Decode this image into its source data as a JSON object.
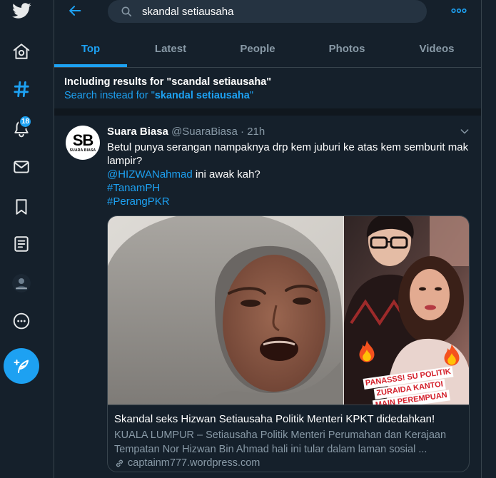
{
  "theme": {
    "bg": "#15202b",
    "border": "#38444d",
    "accent": "#1da1f2",
    "text": "#ffffff",
    "muted": "#8899a6",
    "search_bg": "#253341",
    "separator": "#10171e"
  },
  "sidebar": {
    "icons": [
      "twitter-logo",
      "home",
      "explore",
      "notifications",
      "messages",
      "bookmarks",
      "lists",
      "profile",
      "more",
      "compose-tweet"
    ],
    "active": "explore",
    "notifications_badge": "18"
  },
  "header": {
    "icons": [
      "back-arrow",
      "search",
      "more"
    ],
    "search": {
      "value": "skandal setiausaha"
    }
  },
  "tabs": [
    {
      "label": "Top",
      "active": true
    },
    {
      "label": "Latest",
      "active": false
    },
    {
      "label": "People",
      "active": false
    },
    {
      "label": "Photos",
      "active": false
    },
    {
      "label": "Videos",
      "active": false
    }
  ],
  "search_suggestion": {
    "including": "Including results for \"scandal setiausaha\"",
    "instead_prefix": "Search instead for \"",
    "instead_query": "skandal setiausaha",
    "instead_suffix": "\""
  },
  "tweet": {
    "avatar": {
      "initials": "SB",
      "caption": "SUARA BIASA"
    },
    "author_name": "Suara Biasa",
    "handle": "@SuaraBiasa",
    "separator": "·",
    "time": "21h",
    "text": "Betul punya serangan nampaknya drp kem juburi ke atas kem semburit mak lampir?",
    "mention": "@HIZWANahmad",
    "mention_text": "ini awak kah?",
    "hashtags": [
      "#TanamPH",
      "#PerangPKR"
    ],
    "card": {
      "image_overlay": [
        "PANASSS! SU POLITIK",
        "ZURAIDA KANTOI",
        "MAIN PEREMPUAN"
      ],
      "title": "Skandal seks Hizwan Setiausaha Politik Menteri KPKT didedahkan!",
      "description": "KUALA LUMPUR – Setiausaha Politik Menteri Perumahan dan Kerajaan Tempatan Nor Hizwan Bin Ahmad hali ini tular dalam laman sosial ...",
      "domain": "captainm777.wordpress.com"
    }
  }
}
